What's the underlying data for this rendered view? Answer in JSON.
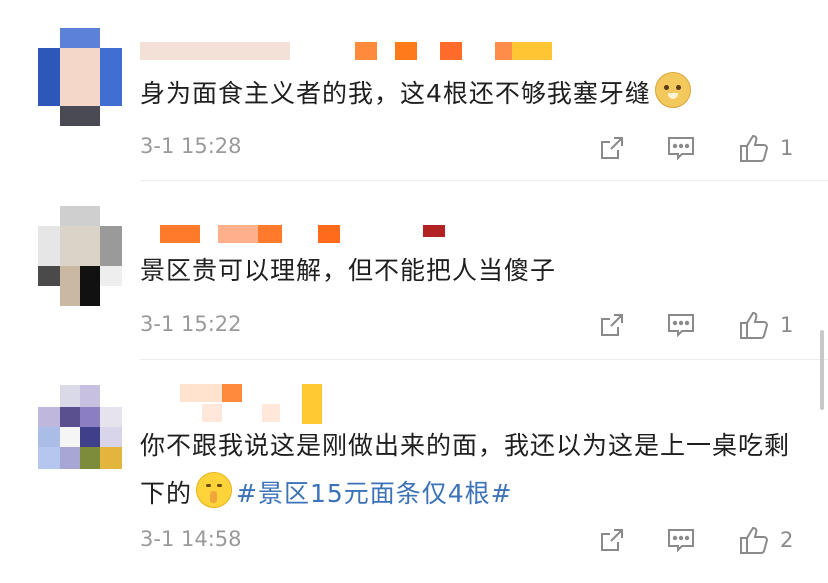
{
  "comments": [
    {
      "text": "身为面食主义者的我，这4根还不够我塞牙缝",
      "time": "3-1 15:28",
      "likes": "1",
      "emoji": "doge-emoji"
    },
    {
      "text": "景区贵可以理解，但不能把人当傻子",
      "time": "3-1 15:22",
      "likes": "1"
    },
    {
      "text_part1": "你不跟我说这是刚做出来的面，我还以为这是上一桌吃剩下的",
      "emoji": "shush-emoji",
      "hashtag": "#景区15元面条仅4根#",
      "time": "3-1 14:58",
      "likes": "2"
    }
  ],
  "icons": {
    "share": "share-icon",
    "comment": "comment-icon",
    "like": "thumbs-up-icon"
  },
  "colors": {
    "text": "#1f1f1f",
    "meta": "#9a9a9a",
    "hashtag": "#3b72b8",
    "divider": "#ececec"
  }
}
